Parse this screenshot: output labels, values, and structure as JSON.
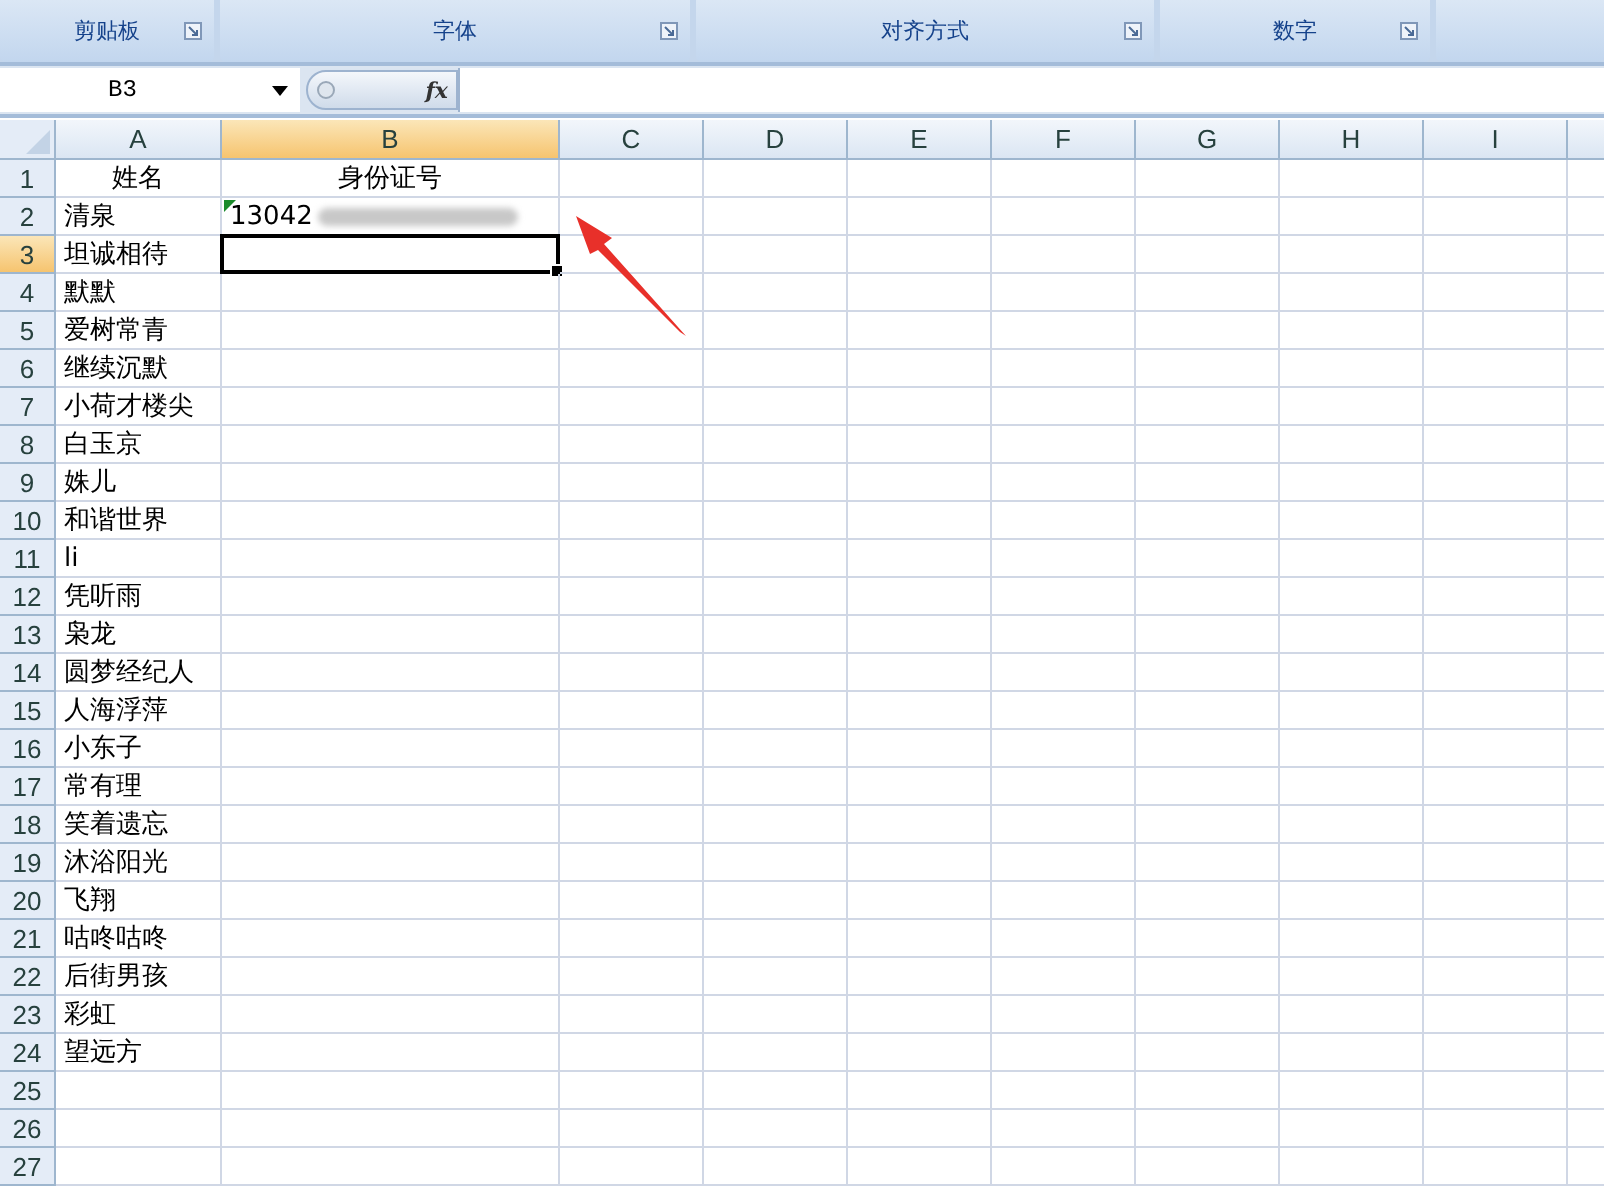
{
  "ribbon_groups": [
    {
      "label": "剪贴板"
    },
    {
      "label": "字体"
    },
    {
      "label": "对齐方式"
    },
    {
      "label": "数字"
    }
  ],
  "formula_bar": {
    "name_box": "B3",
    "fx": "fx"
  },
  "columns": [
    {
      "label": "A",
      "selected": false
    },
    {
      "label": "B",
      "selected": true
    },
    {
      "label": "C",
      "selected": false
    },
    {
      "label": "D",
      "selected": false
    },
    {
      "label": "E",
      "selected": false
    },
    {
      "label": "F",
      "selected": false
    },
    {
      "label": "G",
      "selected": false
    },
    {
      "label": "H",
      "selected": false
    },
    {
      "label": "I",
      "selected": false
    }
  ],
  "rows": [
    {
      "label": "1",
      "selected": false,
      "kind": "heading",
      "error_mark": false,
      "cells": [
        "姓名",
        "身份证号"
      ]
    },
    {
      "label": "2",
      "selected": false,
      "kind": "data",
      "error_mark": true,
      "cells": [
        "清泉",
        "13042"
      ]
    },
    {
      "label": "3",
      "selected": true,
      "kind": "data",
      "error_mark": false,
      "cells": [
        "坦诚相待"
      ]
    },
    {
      "label": "4",
      "selected": false,
      "kind": "data",
      "error_mark": false,
      "cells": [
        "默默"
      ]
    },
    {
      "label": "5",
      "selected": false,
      "kind": "data",
      "error_mark": false,
      "cells": [
        "爱树常青"
      ]
    },
    {
      "label": "6",
      "selected": false,
      "kind": "data",
      "error_mark": false,
      "cells": [
        "继续沉默"
      ]
    },
    {
      "label": "7",
      "selected": false,
      "kind": "data",
      "error_mark": false,
      "cells": [
        "小荷才楼尖"
      ]
    },
    {
      "label": "8",
      "selected": false,
      "kind": "data",
      "error_mark": false,
      "cells": [
        "白玉京"
      ]
    },
    {
      "label": "9",
      "selected": false,
      "kind": "data",
      "error_mark": false,
      "cells": [
        "姝儿"
      ]
    },
    {
      "label": "10",
      "selected": false,
      "kind": "data",
      "error_mark": false,
      "cells": [
        "和谐世界"
      ]
    },
    {
      "label": "11",
      "selected": false,
      "kind": "data",
      "error_mark": false,
      "cells": [
        "li"
      ]
    },
    {
      "label": "12",
      "selected": false,
      "kind": "data",
      "error_mark": false,
      "cells": [
        "凭听雨"
      ]
    },
    {
      "label": "13",
      "selected": false,
      "kind": "data",
      "error_mark": false,
      "cells": [
        "枭龙"
      ]
    },
    {
      "label": "14",
      "selected": false,
      "kind": "data",
      "error_mark": false,
      "cells": [
        "圆梦经纪人"
      ]
    },
    {
      "label": "15",
      "selected": false,
      "kind": "data",
      "error_mark": false,
      "cells": [
        "人海浮萍"
      ]
    },
    {
      "label": "16",
      "selected": false,
      "kind": "data",
      "error_mark": false,
      "cells": [
        "小东子"
      ]
    },
    {
      "label": "17",
      "selected": false,
      "kind": "data",
      "error_mark": false,
      "cells": [
        "常有理"
      ]
    },
    {
      "label": "18",
      "selected": false,
      "kind": "data",
      "error_mark": false,
      "cells": [
        "笑着遗忘"
      ]
    },
    {
      "label": "19",
      "selected": false,
      "kind": "data",
      "error_mark": false,
      "cells": [
        "沐浴阳光"
      ]
    },
    {
      "label": "20",
      "selected": false,
      "kind": "data",
      "error_mark": false,
      "cells": [
        "飞翔"
      ]
    },
    {
      "label": "21",
      "selected": false,
      "kind": "data",
      "error_mark": false,
      "cells": [
        "咕咚咕咚"
      ]
    },
    {
      "label": "22",
      "selected": false,
      "kind": "data",
      "error_mark": false,
      "cells": [
        "后街男孩"
      ]
    },
    {
      "label": "23",
      "selected": false,
      "kind": "data",
      "error_mark": false,
      "cells": [
        "彩虹"
      ]
    },
    {
      "label": "24",
      "selected": false,
      "kind": "data",
      "error_mark": false,
      "cells": [
        "望远方"
      ]
    },
    {
      "label": "25",
      "selected": false,
      "kind": "data",
      "error_mark": false,
      "cells": []
    },
    {
      "label": "26",
      "selected": false,
      "kind": "data",
      "error_mark": false,
      "cells": []
    },
    {
      "label": "27",
      "selected": false,
      "kind": "data",
      "error_mark": false,
      "cells": []
    }
  ]
}
